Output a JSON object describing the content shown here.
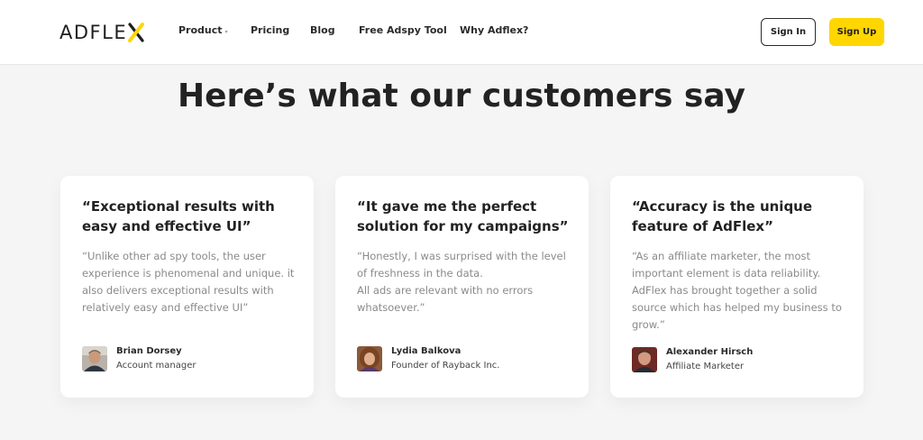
{
  "header": {
    "logo_text": "ADFLEX",
    "logo_text_part": "ADFLE",
    "nav": {
      "product": "Product",
      "pricing": "Pricing",
      "blog": "Blog",
      "adspy": "Free Adspy Tool",
      "why": "Why Adflex?"
    },
    "signin_label": "Sign In",
    "signup_label": "Sign Up"
  },
  "colors": {
    "accent": "#ffd600",
    "background": "#f5f5f6",
    "card": "#ffffff",
    "text": "#222222",
    "muted": "#8a8a8a"
  },
  "section": {
    "heading": "Here’s what our customers say"
  },
  "testimonials": [
    {
      "title": "“Exceptional results with easy and effective UI”",
      "body": "“Unlike other ad spy tools, the user experience is phenomenal and unique. it also delivers exceptional results with relatively easy and effective UI”",
      "name": "Brian Dorsey",
      "role": "Account manager"
    },
    {
      "title": "“It gave me the perfect solution for my campaigns”",
      "body": "“Honestly, I was surprised with the level of freshness in the data.\nAll ads are relevant with no errors whatsoever.”",
      "name": "Lydia Balkova",
      "role": "Founder of Rayback Inc."
    },
    {
      "title": "“Accuracy is the unique feature of AdFlex”",
      "body": "“As an affiliate marketer, the most important element is data reliability. AdFlex has brought together a solid source which has helped my business to grow.”",
      "name": "Alexander Hirsch",
      "role": "Affiliate Marketer"
    }
  ]
}
